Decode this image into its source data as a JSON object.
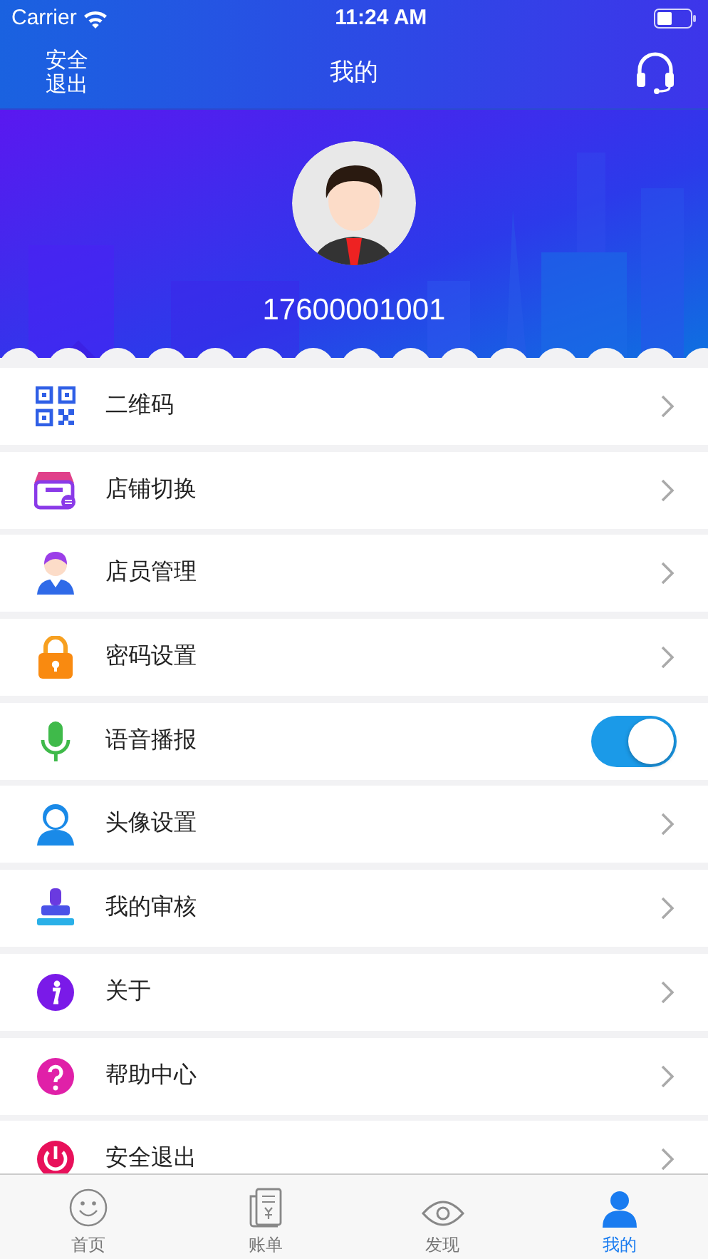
{
  "status_bar": {
    "carrier": "Carrier",
    "time": "11:24 AM"
  },
  "nav": {
    "left_action": "安全退出",
    "title": "我的"
  },
  "profile": {
    "phone": "17600001001"
  },
  "menu": [
    {
      "label": "二维码",
      "kind": "link"
    },
    {
      "label": "店铺切换",
      "kind": "link"
    },
    {
      "label": "店员管理",
      "kind": "link"
    },
    {
      "label": "密码设置",
      "kind": "link"
    },
    {
      "label": "语音播报",
      "kind": "toggle",
      "on": true
    },
    {
      "label": "头像设置",
      "kind": "link"
    },
    {
      "label": "我的审核",
      "kind": "link"
    },
    {
      "label": "关于",
      "kind": "link"
    },
    {
      "label": "帮助中心",
      "kind": "link"
    },
    {
      "label": "安全退出",
      "kind": "link"
    }
  ],
  "tab_bar": [
    {
      "label": "首页",
      "selected": false
    },
    {
      "label": "账单",
      "selected": false
    },
    {
      "label": "发现",
      "selected": false
    },
    {
      "label": "我的",
      "selected": true
    }
  ]
}
